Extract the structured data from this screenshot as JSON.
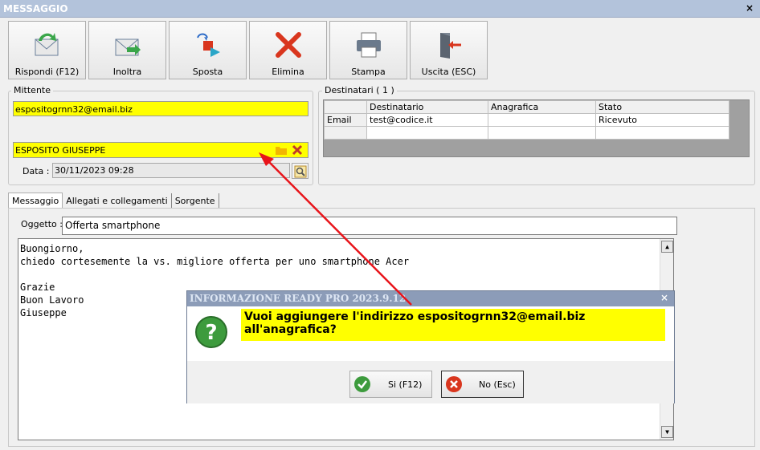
{
  "window": {
    "title": "MESSAGGIO",
    "close": "×"
  },
  "toolbar": [
    {
      "label": "Rispondi (F12)",
      "icon": "reply-envelope-icon"
    },
    {
      "label": "Inoltra",
      "icon": "forward-envelope-icon"
    },
    {
      "label": "Sposta",
      "icon": "move-icon"
    },
    {
      "label": "Elimina",
      "icon": "delete-x-icon"
    },
    {
      "label": "Stampa",
      "icon": "printer-icon"
    },
    {
      "label": "Uscita (ESC)",
      "icon": "exit-door-icon"
    }
  ],
  "sender": {
    "group_title": "Mittente",
    "email": "espositogrnn32@email.biz",
    "name": "ESPOSITO GIUSEPPE",
    "date_label": "Data :",
    "date_value": "30/11/2023 09:28"
  },
  "recipients": {
    "group_title": "Destinatari ( 1 )",
    "columns": [
      "Destinatario",
      "Anagrafica",
      "Stato"
    ],
    "rows": [
      {
        "type": "Email",
        "destinatario": "test@codice.it",
        "anagrafica": "",
        "stato": "Ricevuto"
      }
    ]
  },
  "tabs": [
    "Messaggio",
    "Allegati e collegamenti",
    "Sorgente"
  ],
  "message": {
    "subject_label": "Oggetto :",
    "subject": "Offerta smartphone",
    "body_lines": [
      "Buongiorno,",
      "chiedo cortesemente la vs. migliore offerta per uno smartphone Acer",
      "",
      "Grazie",
      "Buon Lavoro",
      "Giuseppe"
    ]
  },
  "dialog": {
    "title": "INFORMAZIONE READY PRO 2023.9.12",
    "close": "×",
    "message": "Vuoi aggiungere l'indirizzo espositogrnn32@email.biz all'anagrafica?",
    "yes_label": "Si (F12)",
    "no_label": "No (Esc)"
  },
  "colors": {
    "highlight": "#ffff00",
    "title_bar": "#b3c3db",
    "arrow": "#e8141a"
  }
}
